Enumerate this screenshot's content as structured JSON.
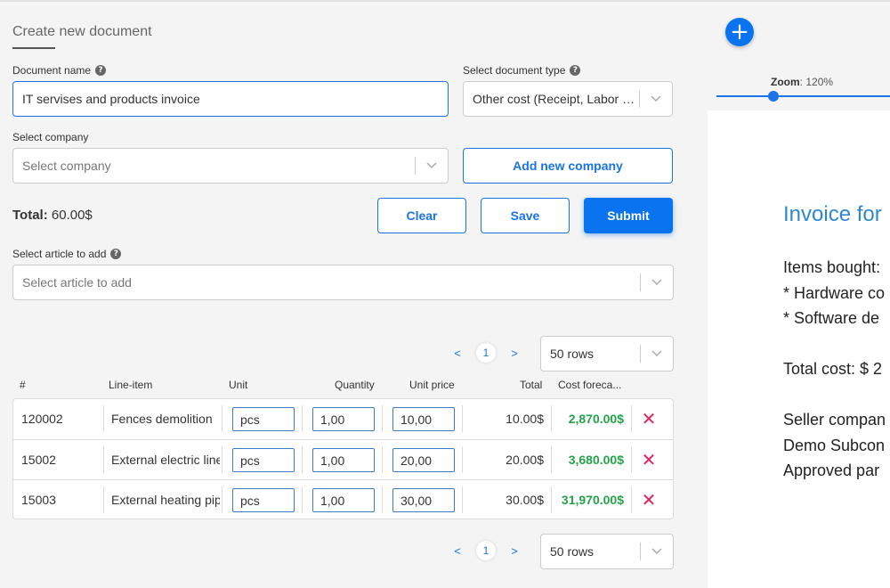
{
  "header": {
    "tab_title": "Create new document"
  },
  "document_name": {
    "label": "Document name",
    "value": "IT servises and products invoice"
  },
  "document_type": {
    "label": "Select document type",
    "value": "Other cost (Receipt, Labor et..."
  },
  "company": {
    "label": "Select company",
    "placeholder": "Select company",
    "add_button": "Add new company"
  },
  "total": {
    "label": "Total:",
    "value": "60.00$"
  },
  "actions": {
    "clear": "Clear",
    "save": "Save",
    "submit": "Submit"
  },
  "article": {
    "label": "Select article to add",
    "placeholder": "Select article to add"
  },
  "pagination": {
    "prev": "<",
    "page": "1",
    "next": ">",
    "rows": "50 rows"
  },
  "table": {
    "headers": [
      "#",
      "Line-item",
      "Unit",
      "Quantity",
      "Unit price",
      "Total",
      "Cost foreca..."
    ],
    "rows": [
      {
        "id": "120002",
        "item": "Fences demolition",
        "unit": "pcs",
        "quantity": "1,00",
        "unit_price": "10,00",
        "total": "10.00$",
        "forecast": "2,870.00$"
      },
      {
        "id": "15002",
        "item": "External electric line",
        "unit": "pcs",
        "quantity": "1,00",
        "unit_price": "20,00",
        "total": "20.00$",
        "forecast": "3,680.00$"
      },
      {
        "id": "15003",
        "item": "External heating pipe",
        "unit": "pcs",
        "quantity": "1,00",
        "unit_price": "30,00",
        "total": "30.00$",
        "forecast": "31,970.00$"
      }
    ]
  },
  "preview": {
    "add_icon": "plus-icon",
    "zoom_label": "Zoom",
    "zoom_value": ": 120%",
    "zoom_level": 0.2,
    "title": "Invoice for",
    "lines": [
      "Items bought:",
      "* Hardware co",
      "* Software de",
      "",
      "Total cost: $ 2",
      "",
      "Seller compan",
      "Demo Subcon",
      "Approved par"
    ]
  },
  "colors": {
    "accent": "#0a73f0",
    "forecast_green": "#22a34a",
    "delete_red": "#e0245e"
  }
}
